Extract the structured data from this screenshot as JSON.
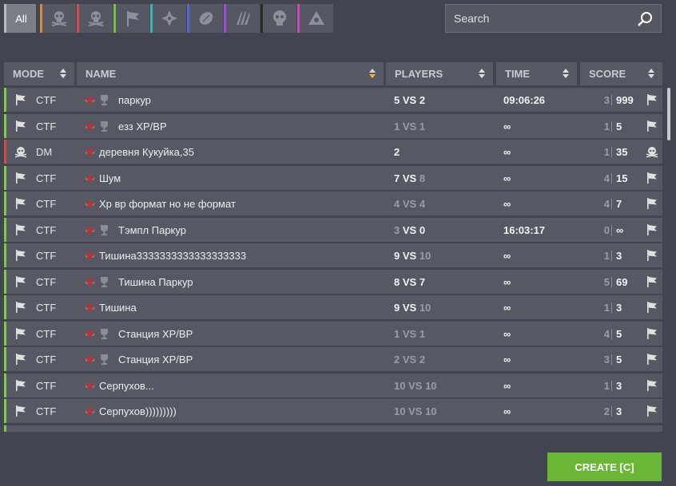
{
  "filters": {
    "all_label": "All",
    "items": [
      {
        "icon": "skull-crossbones-icon",
        "color": "#d68a3a"
      },
      {
        "icon": "skull-crossbones-icon",
        "color": "#d64a4a"
      },
      {
        "icon": "flag-icon",
        "color": "#7dbd45"
      },
      {
        "icon": "compass-icon",
        "color": "#39b6b3"
      },
      {
        "icon": "ball-icon",
        "color": "#5366d8"
      },
      {
        "icon": "claw-icon",
        "color": "#9a4ed6"
      },
      {
        "icon": "skull-icon",
        "color": "#2a2a2a"
      },
      {
        "icon": "nuclear-icon",
        "color": "#c74bb3"
      }
    ]
  },
  "search": {
    "placeholder": "Search"
  },
  "columns": {
    "mode": "MODE",
    "name": "NAME",
    "players": "PLAYERS",
    "time": "TIME",
    "score": "SCORE"
  },
  "rows": [
    {
      "mode": "CTF",
      "mode_color": "#7dcc3f",
      "trophy": true,
      "name": "паркур",
      "players_a": "5",
      "vs": "VS",
      "players_b": "2",
      "dim_a": false,
      "dim_vs": false,
      "dim_b": false,
      "time": "09:06:26",
      "score_left": "3",
      "score_right": "999"
    },
    {
      "mode": "CTF",
      "mode_color": "#7dcc3f",
      "trophy": true,
      "name": "езз ХР/ВР",
      "players_a": "1",
      "vs": "VS",
      "players_b": "1",
      "dim_a": true,
      "dim_vs": true,
      "dim_b": true,
      "time": "∞",
      "score_left": "1",
      "score_right": "5"
    },
    {
      "mode": "DM",
      "mode_color": "#d94848",
      "trophy": false,
      "name": "деревня Кукуйка,35",
      "players_a": "2",
      "vs": "",
      "players_b": "",
      "dim_a": false,
      "dim_vs": false,
      "dim_b": false,
      "time": "∞",
      "score_left": "1",
      "score_right": "35"
    },
    {
      "mode": "CTF",
      "mode_color": "#7dcc3f",
      "trophy": false,
      "name": "Шум",
      "players_a": "7",
      "vs": "VS",
      "players_b": "8",
      "dim_a": false,
      "dim_vs": false,
      "dim_b": true,
      "time": "∞",
      "score_left": "4",
      "score_right": "15"
    },
    {
      "mode": "CTF",
      "mode_color": "#7dcc3f",
      "trophy": false,
      "name": "Хр вр формат но не формат",
      "players_a": "4",
      "vs": "VS",
      "players_b": "4",
      "dim_a": true,
      "dim_vs": true,
      "dim_b": true,
      "time": "∞",
      "score_left": "4",
      "score_right": "7"
    },
    {
      "mode": "CTF",
      "mode_color": "#7dcc3f",
      "trophy": true,
      "name": "Тэмпл Паркур",
      "players_a": "3",
      "vs": "VS",
      "players_b": "0",
      "dim_a": true,
      "dim_vs": false,
      "dim_b": false,
      "time": "16:03:17",
      "score_left": "0",
      "score_right": "∞"
    },
    {
      "mode": "CTF",
      "mode_color": "#7dcc3f",
      "trophy": false,
      "name": "Тишина3333333333333333333",
      "players_a": "9",
      "vs": "VS",
      "players_b": "10",
      "dim_a": false,
      "dim_vs": false,
      "dim_b": true,
      "time": "∞",
      "score_left": "1",
      "score_right": "3"
    },
    {
      "mode": "CTF",
      "mode_color": "#7dcc3f",
      "trophy": true,
      "name": "Тишина Паркур",
      "players_a": "8",
      "vs": "VS",
      "players_b": "7",
      "dim_a": false,
      "dim_vs": false,
      "dim_b": false,
      "time": "∞",
      "score_left": "5",
      "score_right": "69"
    },
    {
      "mode": "CTF",
      "mode_color": "#7dcc3f",
      "trophy": false,
      "name": "Тишина",
      "players_a": "9",
      "vs": "VS",
      "players_b": "10",
      "dim_a": false,
      "dim_vs": false,
      "dim_b": true,
      "time": "∞",
      "score_left": "1",
      "score_right": "3"
    },
    {
      "mode": "CTF",
      "mode_color": "#7dcc3f",
      "trophy": true,
      "name": "Станция ХР/ВР",
      "players_a": "1",
      "vs": "VS",
      "players_b": "1",
      "dim_a": true,
      "dim_vs": true,
      "dim_b": true,
      "time": "∞",
      "score_left": "4",
      "score_right": "5"
    },
    {
      "mode": "CTF",
      "mode_color": "#7dcc3f",
      "trophy": true,
      "name": "Станция ХР/ВР",
      "players_a": "2",
      "vs": "VS",
      "players_b": "2",
      "dim_a": true,
      "dim_vs": true,
      "dim_b": true,
      "time": "∞",
      "score_left": "3",
      "score_right": "5"
    },
    {
      "mode": "CTF",
      "mode_color": "#7dcc3f",
      "trophy": false,
      "name": "Серпухов...",
      "players_a": "10",
      "vs": "VS",
      "players_b": "10",
      "dim_a": true,
      "dim_vs": true,
      "dim_b": true,
      "time": "∞",
      "score_left": "1",
      "score_right": "3"
    },
    {
      "mode": "CTF",
      "mode_color": "#7dcc3f",
      "trophy": false,
      "name": "Серпухов)))))))))",
      "players_a": "10",
      "vs": "VS",
      "players_b": "10",
      "dim_a": true,
      "dim_vs": true,
      "dim_b": true,
      "time": "∞",
      "score_left": "2",
      "score_right": "3"
    }
  ],
  "create_button": {
    "label": "CREATE [C]"
  }
}
